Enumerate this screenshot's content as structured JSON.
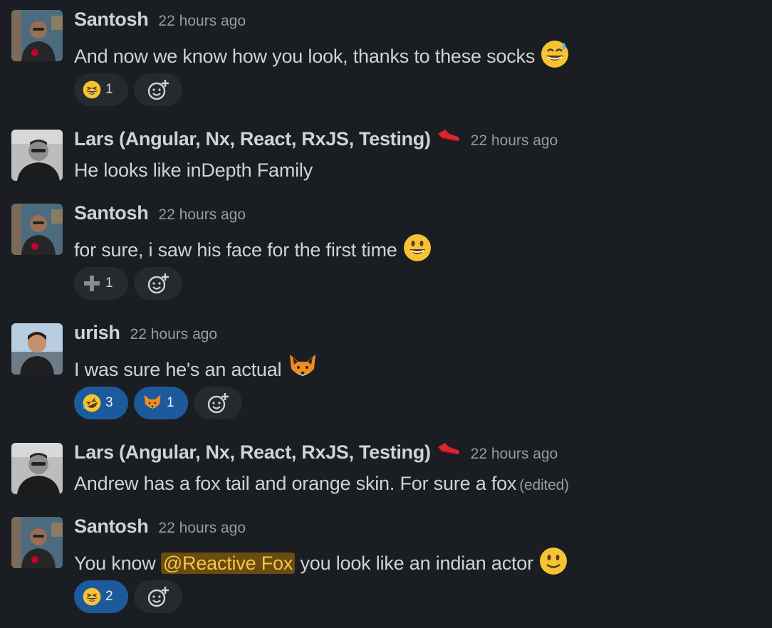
{
  "messages": [
    {
      "author": "Santosh",
      "time": "22 hours ago",
      "text": "And now we know how you look, thanks to these socks",
      "text_emoji": "sweat-smile",
      "reactions": [
        {
          "emoji": "grinning-squint",
          "count": "1",
          "active": false
        }
      ]
    },
    {
      "author": "Lars (Angular, Nx, React, RxJS, Testing)",
      "time": "22 hours ago",
      "text": "He looks like inDepth Family",
      "badge": "red-shoe"
    },
    {
      "author": "Santosh",
      "time": "22 hours ago",
      "text": "for sure, i saw his face for the first time",
      "text_emoji": "smiley",
      "reactions": [
        {
          "emoji": "plus",
          "count": "1",
          "active": false
        }
      ]
    },
    {
      "author": "urish",
      "time": "22 hours ago",
      "text": "I was sure he's an actual",
      "text_emoji": "fox",
      "reactions": [
        {
          "emoji": "rofl",
          "count": "3",
          "active": true
        },
        {
          "emoji": "fox",
          "count": "1",
          "active": true
        }
      ]
    },
    {
      "author": "Lars (Angular, Nx, React, RxJS, Testing)",
      "time": "22 hours ago",
      "text": "Andrew has a fox tail and orange skin. For sure a fox",
      "edited": "(edited)",
      "badge": "red-shoe"
    },
    {
      "author": "Santosh",
      "time": "22 hours ago",
      "text_before": "You know",
      "mention": "@Reactive Fox",
      "text_after": "you look like an indian actor",
      "text_emoji": "slight-smile",
      "reactions": [
        {
          "emoji": "grinning-squint",
          "count": "2",
          "active": true
        }
      ]
    }
  ],
  "colors": {
    "background": "#1a1d21",
    "mention_bg": "#6a4b12",
    "mention_fg": "#f2c744",
    "reaction_active": "#1d5a9c"
  }
}
